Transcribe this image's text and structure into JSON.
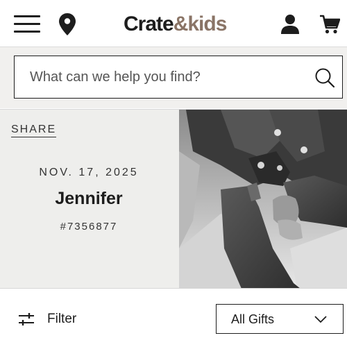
{
  "header": {
    "logo_part1": "Crate",
    "logo_part2": "&kids",
    "menu_icon": "hamburger-menu-icon",
    "location_icon": "map-pin-icon",
    "account_icon": "user-icon",
    "cart_icon": "shopping-cart-icon",
    "brand_accent": "#8a7466"
  },
  "search": {
    "placeholder": "What can we help you find?",
    "value": "",
    "icon": "search-icon"
  },
  "registry": {
    "share_label": "SHARE",
    "date": "NOV. 17, 2025",
    "name": "Jennifer",
    "number": "#7356877",
    "photo": "black-and-white photo of hands holding a baby's feet"
  },
  "filter": {
    "label": "Filter",
    "icon": "sliders-icon",
    "select_value": "All Gifts",
    "select_icon": "chevron-down-icon"
  }
}
